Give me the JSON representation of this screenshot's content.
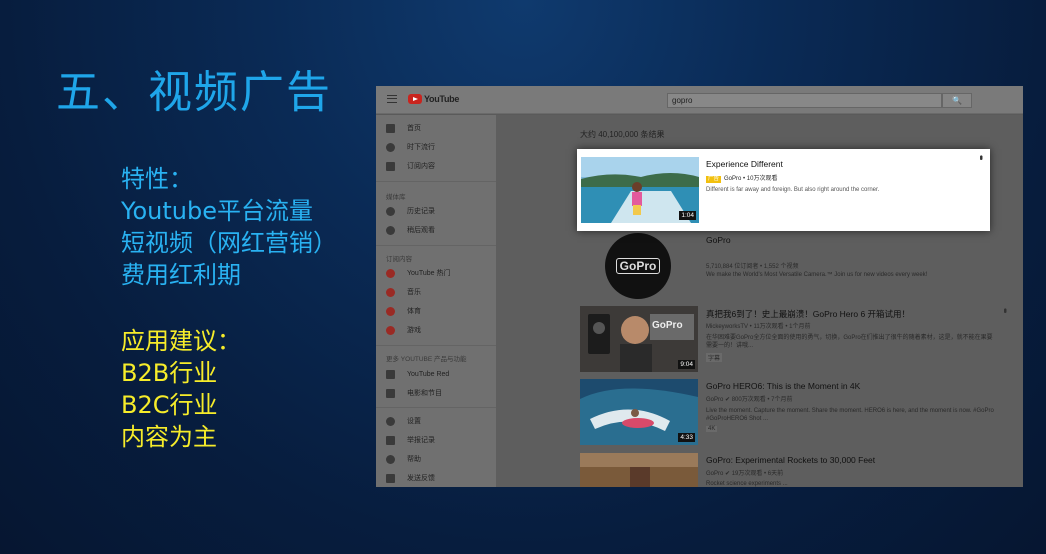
{
  "slide": {
    "title": "五、视频广告",
    "features": [
      "特性：",
      "Youtube平台流量",
      "短视频（网红营销）",
      "费用红利期"
    ],
    "advice": [
      "应用建议：",
      "B2B行业",
      "B2C行业",
      "内容为主"
    ]
  },
  "youtube": {
    "logo_text": "YouTube",
    "search_value": "gopro",
    "search_button": "🔍",
    "sidebar": {
      "items_top": [
        {
          "icon": "home-icon",
          "label": "首页"
        },
        {
          "icon": "trending-icon",
          "label": "时下流行"
        },
        {
          "icon": "subscriptions-icon",
          "label": "订阅内容"
        }
      ],
      "library_header": "媒体库",
      "library_items": [
        {
          "icon": "history-icon",
          "label": "历史记录"
        },
        {
          "icon": "watch-later-icon",
          "label": "稍后观看"
        }
      ],
      "subs_header": "订阅内容",
      "subs_items": [
        {
          "icon": "youtube-popular-icon",
          "label": "YouTube 热门"
        },
        {
          "icon": "music-icon",
          "label": "音乐"
        },
        {
          "icon": "sports-icon",
          "label": "体育"
        },
        {
          "icon": "gaming-icon",
          "label": "游戏"
        }
      ],
      "more_header": "更多 YOUTUBE 产品与功能",
      "more_items": [
        {
          "icon": "youtube-red-icon",
          "label": "YouTube Red"
        },
        {
          "icon": "movies-icon",
          "label": "电影和节目"
        }
      ],
      "bottom_items": [
        {
          "icon": "settings-icon",
          "label": "设置"
        },
        {
          "icon": "flag-icon",
          "label": "举报记录"
        },
        {
          "icon": "help-icon",
          "label": "帮助"
        },
        {
          "icon": "feedback-icon",
          "label": "发送反馈"
        }
      ]
    },
    "results_count": "大约 40,100,000 条结果",
    "ad_card": {
      "title": "Experience Different",
      "badge": "广告",
      "meta": "GoPro • 10万次观看",
      "desc": "Different is far away and foreign. But also right around the corner.",
      "duration": "1:04"
    },
    "channel": {
      "name": "GoPro",
      "logo_text": "GoPro",
      "meta": "5,710,884 位订阅者 • 1,552 个视频",
      "desc": "We make the World's Most Versatile Camera.™ Join us for new videos every week!"
    },
    "videos": [
      {
        "title": "真把我6到了！史上最崩溃！GoPro Hero 6 开箱试用！",
        "meta": "MickeyworksTV • 11万次观看 • 1个月前",
        "desc": "在华困难要GoPro全方位全面的使用的勇气，切换，GoPro在们推出了很牛的随着素材，这是，就不能在果要需要一的！讲哦...",
        "badge": "字幕",
        "duration": "9:04",
        "thumb_text": "GoPro"
      },
      {
        "title": "GoPro HERO6: This is the Moment in 4K",
        "meta": "GoPro ✔ 800万次观看 • 7个月前",
        "desc": "Live the moment. Capture the moment. Share the moment. HERO6 is here, and the moment is now. #GoPro #GoProHERO6 Shot ...",
        "badge": "4K",
        "duration": "4:33"
      },
      {
        "title": "GoPro: Experimental Rockets to 30,000 Feet",
        "meta": "GoPro ✔ 19万次观看 • 6天前",
        "desc": "Rocket science experiments ..."
      }
    ]
  }
}
